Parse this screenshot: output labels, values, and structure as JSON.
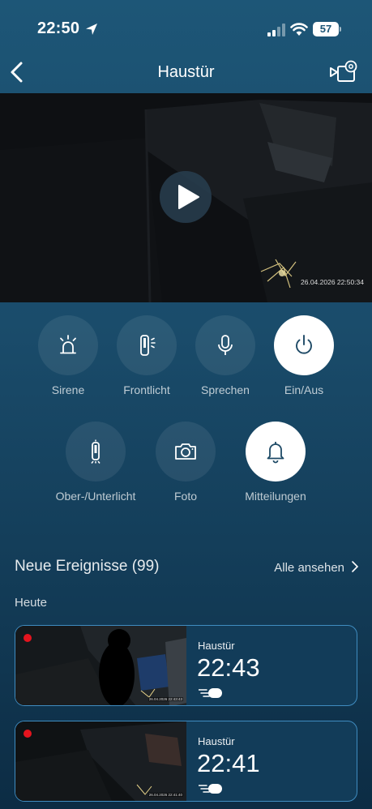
{
  "status_bar": {
    "time": "22:50",
    "battery": "57"
  },
  "nav": {
    "title": "Haustür"
  },
  "video": {
    "timestamp": "26.04.2026 22:50:34"
  },
  "controls": [
    {
      "label": "Sirene",
      "icon": "siren-icon",
      "active": false
    },
    {
      "label": "Frontlicht",
      "icon": "front-light-icon",
      "active": false
    },
    {
      "label": "Sprechen",
      "icon": "microphone-icon",
      "active": false
    },
    {
      "label": "Ein/Aus",
      "icon": "power-icon",
      "active": true
    },
    {
      "label": "Ober-/Unterlicht",
      "icon": "up-down-light-icon",
      "active": false
    },
    {
      "label": "Foto",
      "icon": "camera-icon",
      "active": false
    },
    {
      "label": "Mitteilungen",
      "icon": "bell-icon",
      "active": true
    }
  ],
  "events": {
    "title": "Neue Ereignisse (99)",
    "view_all": "Alle ansehen",
    "group_label": "Heute",
    "items": [
      {
        "camera": "Haustür",
        "time": "22:43",
        "thumb_stamp": "26.04.2026 22:43:43",
        "motion_icon": "motion-icon"
      },
      {
        "camera": "Haustür",
        "time": "22:41",
        "thumb_stamp": "26.04.2026 22:41:40",
        "motion_icon": "motion-icon"
      }
    ]
  },
  "colors": {
    "accent_border": "#3f8cc0",
    "record": "#e5141e",
    "background": "#1c5272"
  }
}
